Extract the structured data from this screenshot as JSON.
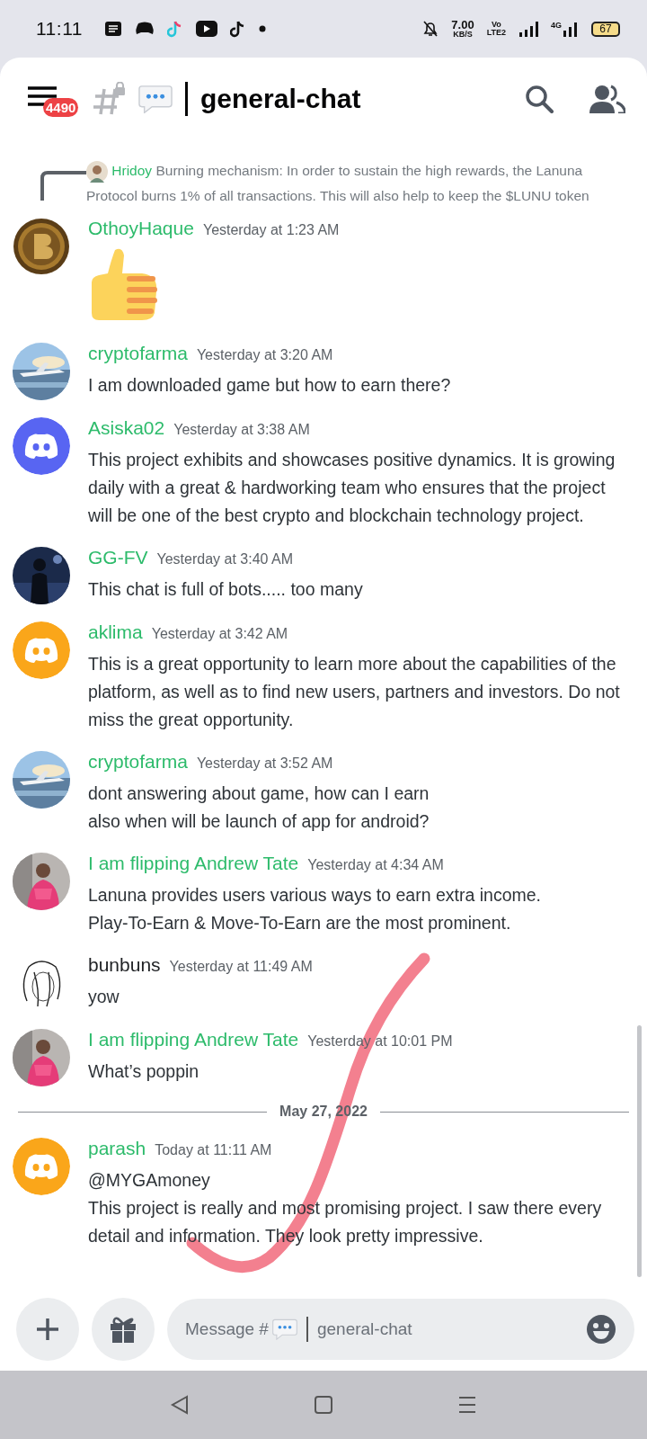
{
  "status_bar": {
    "time": "11:11",
    "speed": "7.00",
    "speed_unit": "KB/S",
    "volte": "Vo",
    "lte": "LTE2",
    "network": "4G",
    "battery": "67"
  },
  "header": {
    "badge": "4490",
    "channel": "general-chat"
  },
  "reply": {
    "author": "Hridoy",
    "text": "Burning mechanism: In order to sustain the high rewards, the Lanuna Protocol burns 1% of all transactions. This will also help to keep the $LUNU token"
  },
  "messages": [
    {
      "author": "OthoyHaque",
      "color": "#2dbb6b",
      "time": "Yesterday at 1:23 AM",
      "avatar": {
        "kind": "coin"
      },
      "kind": "emoji"
    },
    {
      "author": "cryptofarma",
      "color": "#2dbb6b",
      "time": "Yesterday at 3:20 AM",
      "avatar": {
        "kind": "picture"
      },
      "kind": "text",
      "lines": [
        "I am downloaded game but how to earn there?"
      ]
    },
    {
      "author": "Asiska02",
      "color": "#2dbb6b",
      "time": "Yesterday at 3:38 AM",
      "avatar": {
        "kind": "logo",
        "color": "#5865f2"
      },
      "kind": "text",
      "lines": [
        "This project exhibits and showcases positive dynamics. It is growing daily with a great & hardworking team who ensures that the project will be one of the best crypto and blockchain technology project."
      ]
    },
    {
      "author": "GG-FV",
      "color": "#2dbb6b",
      "time": "Yesterday at 3:40 AM",
      "avatar": {
        "kind": "picture"
      },
      "kind": "text",
      "lines": [
        "This chat is full of bots..... too many"
      ]
    },
    {
      "author": "aklima",
      "color": "#2dbb6b",
      "time": "Yesterday at 3:42 AM",
      "avatar": {
        "kind": "logo",
        "color": "#faa61a"
      },
      "kind": "text",
      "lines": [
        "This is a great opportunity to learn more about the capabilities of the platform, as well as to find new users, partners and investors. Do not miss the great opportunity."
      ]
    },
    {
      "author": "cryptofarma",
      "color": "#2dbb6b",
      "time": "Yesterday at 3:52 AM",
      "avatar": {
        "kind": "picture"
      },
      "kind": "text",
      "lines": [
        "dont answering about game, how can I earn",
        "also when will be launch of app for android?"
      ]
    },
    {
      "author": "I am flipping Andrew Tate",
      "color": "#2dbb6b",
      "time": "Yesterday at 4:34 AM",
      "avatar": {
        "kind": "picture"
      },
      "kind": "text",
      "lines": [
        "Lanuna provides users various ways to earn extra income.",
        "Play-To-Earn & Move-To-Earn are the most prominent."
      ]
    },
    {
      "author": "bunbuns",
      "color": "#1f2124",
      "time": "Yesterday at 11:49 AM",
      "avatar": {
        "kind": "sketch"
      },
      "kind": "text",
      "lines": [
        "yow"
      ]
    },
    {
      "author": "I am flipping Andrew Tate",
      "color": "#2dbb6b",
      "time": "Yesterday at 10:01 PM",
      "avatar": {
        "kind": "picture"
      },
      "kind": "text",
      "lines": [
        "What’s poppin"
      ]
    },
    {
      "kind": "divider",
      "date": "May 27, 2022"
    },
    {
      "author": "parash",
      "color": "#2dbb6b",
      "time": "Today at 11:11 AM",
      "avatar": {
        "kind": "logo",
        "color": "#faa61a"
      },
      "kind": "text",
      "lines": [
        "@MYGAmoney",
        "This project is really and most promising project. I saw there every detail and information. They look pretty impressive."
      ]
    }
  ],
  "composer": {
    "placeholder_start": "Message #",
    "placeholder_end": "general-chat"
  }
}
